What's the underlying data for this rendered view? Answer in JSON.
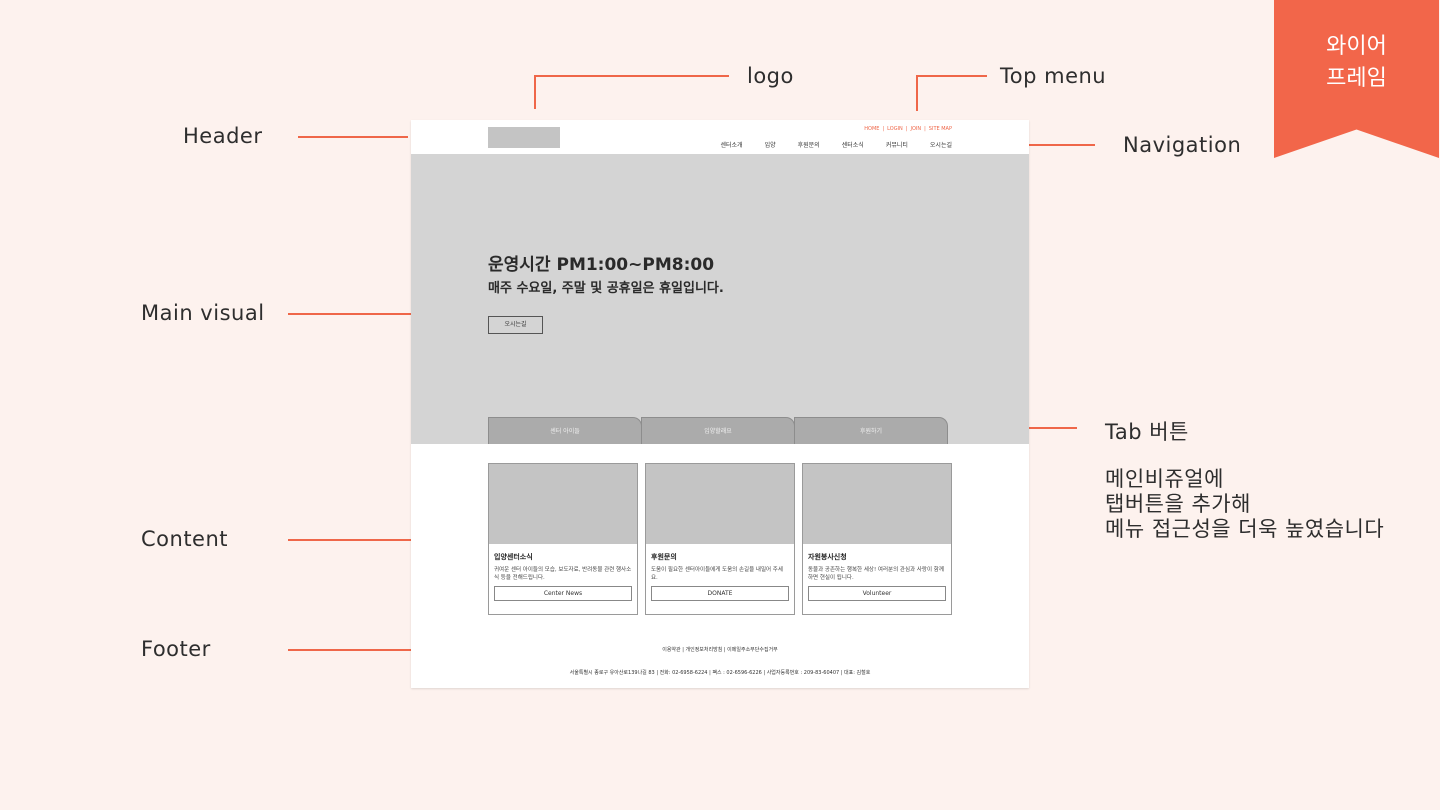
{
  "badge": {
    "line1": "와이어",
    "line2": "프레임"
  },
  "annotations": {
    "logo": "logo",
    "top_menu": "Top menu",
    "header": "Header",
    "navigation": "Navigation",
    "main_visual": "Main visual",
    "tab_button": "Tab 버튼",
    "tab_note": [
      "메인비쥬얼에",
      "탭버튼을 추가해",
      "메뉴 접근성을 더욱 높였습니다"
    ],
    "content": "Content",
    "footer": "Footer"
  },
  "wireframe": {
    "top_menu": [
      "HOME",
      "LOGIN",
      "JOIN",
      "SITE MAP"
    ],
    "top_menu_separator": "|",
    "nav": [
      "센터소개",
      "입양",
      "후원문의",
      "센터소식",
      "커뮤니티",
      "오시는길"
    ],
    "visual": {
      "headline": "운영시간 PM1:00~PM8:00",
      "subline": "매주 수요일, 주말 및 공휴일은 휴일입니다.",
      "button": "오시는길"
    },
    "tabs": [
      "센터 아이들",
      "입양할래요",
      "후원하기"
    ],
    "cards": [
      {
        "title": "입양센터소식",
        "desc": "귀여운 센터 아이들의 모습, 보도자료, 반려동물 관련 행사소식 등을 전해드립니다.",
        "button": "Center News"
      },
      {
        "title": "후원문의",
        "desc": "도움이 필요한 센터아이들에게 도움의 손길을 내밀어 주세요.",
        "button": "DONATE"
      },
      {
        "title": "자원봉사신청",
        "desc": "동물과 공존하는 행복한 세상! 여러분의 관심과 사랑이 함께하면 현실이 됩니다.",
        "button": "Volunteer"
      }
    ],
    "footer_links": "이용약관 | 개인정보처리방침 | 이메일주소무단수집거부",
    "footer_address": "서울특별시 종로구 유아산로139나길 83 | 전화: 02-6958-6224 | 팩스 : 02-6596-6226 | 사업자등록번호 : 209-83-60407 | 대표: 김철호"
  },
  "colors": {
    "accent": "#f2664a",
    "background": "#fdf2ee",
    "placeholder": "#c4c4c4",
    "visual_bg": "#d4d4d4"
  }
}
